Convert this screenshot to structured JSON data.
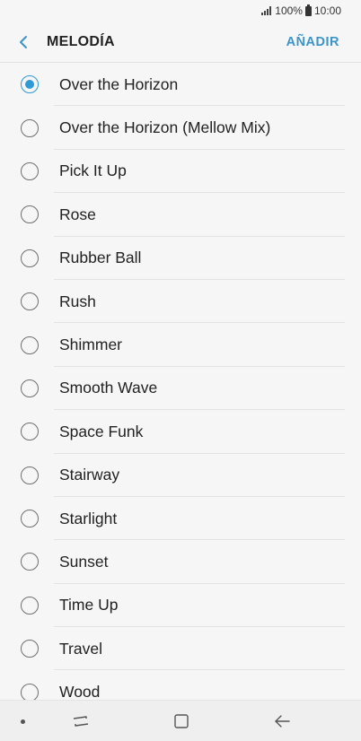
{
  "status_bar": {
    "battery": "100%",
    "time": "10:00"
  },
  "app_bar": {
    "title": "MELODÍA",
    "add_label": "AÑADIR"
  },
  "ringtones": [
    {
      "label": "Over the Horizon",
      "selected": true
    },
    {
      "label": "Over the Horizon (Mellow Mix)",
      "selected": false
    },
    {
      "label": "Pick It Up",
      "selected": false
    },
    {
      "label": "Rose",
      "selected": false
    },
    {
      "label": "Rubber Ball",
      "selected": false
    },
    {
      "label": "Rush",
      "selected": false
    },
    {
      "label": "Shimmer",
      "selected": false
    },
    {
      "label": "Smooth Wave",
      "selected": false
    },
    {
      "label": "Space Funk",
      "selected": false
    },
    {
      "label": "Stairway",
      "selected": false
    },
    {
      "label": "Starlight",
      "selected": false
    },
    {
      "label": "Sunset",
      "selected": false
    },
    {
      "label": "Time Up",
      "selected": false
    },
    {
      "label": "Travel",
      "selected": false
    },
    {
      "label": "Wood",
      "selected": false
    }
  ],
  "colors": {
    "accent": "#2f9ad4",
    "action_text": "#3d94c8"
  },
  "icons": {
    "back": "chevron-left-icon",
    "recent": "recent-apps-icon",
    "home": "home-icon",
    "nav_back": "back-arrow-icon"
  }
}
